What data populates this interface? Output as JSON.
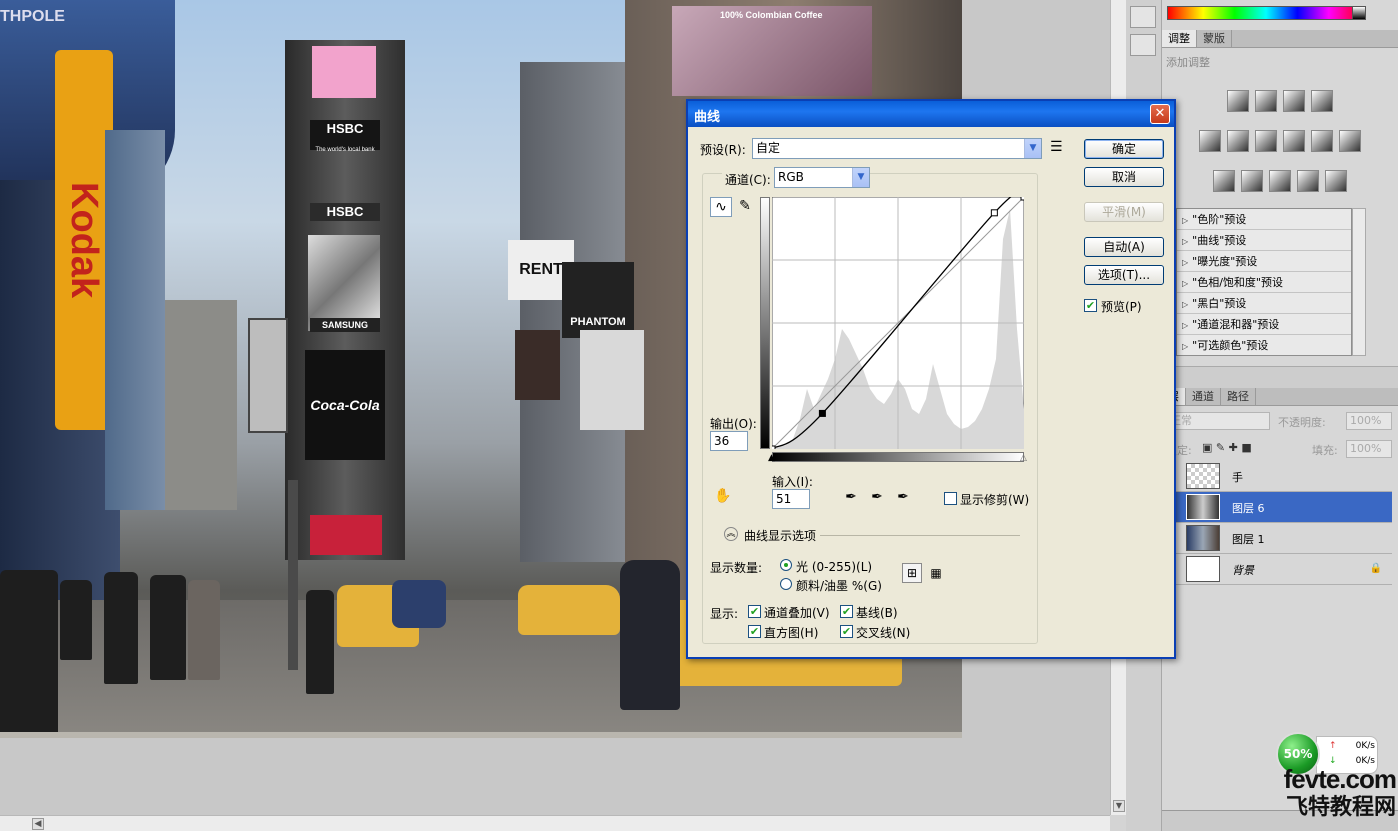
{
  "canvas": {
    "signs": {
      "kodak": "Kodak",
      "hsbc1": "HSBC",
      "hsbc_tagline": "The world's local bank",
      "hsbc2": "HSBC",
      "samsung": "SAMSUNG",
      "coca_cola": "Coca-Cola",
      "rent": "RENT",
      "phantom": "PHANTOM",
      "colombian": "100% Colombian Coffee",
      "thpole": "THPOLE"
    }
  },
  "dialog": {
    "title": "曲线",
    "preset_label": "预设(R):",
    "preset_value": "自定",
    "channel_label": "通道(C):",
    "channel_value": "RGB",
    "buttons": {
      "ok": "确定",
      "cancel": "取消",
      "smooth": "平滑(M)",
      "auto": "自动(A)",
      "options": "选项(T)..."
    },
    "preview_label": "预览(P)",
    "output_label": "输出(O):",
    "output_value": "36",
    "input_label": "输入(I):",
    "input_value": "51",
    "show_clipping_label": "显示修剪(W)",
    "display_options_label": "曲线显示选项",
    "show_amount_label": "显示数量:",
    "light_label": "光 (0-255)(L)",
    "pigment_label": "颜料/油墨 %(G)",
    "show_label": "显示:",
    "channel_overlay_label": "通道叠加(V)",
    "baseline_label": "基线(B)",
    "histogram_label": "直方图(H)",
    "intersection_label": "交叉线(N)"
  },
  "curve": {
    "points": [
      [
        0,
        0
      ],
      [
        51,
        36
      ],
      [
        225,
        239
      ],
      [
        255,
        255
      ]
    ],
    "selected_point": [
      51,
      36
    ]
  },
  "panels": {
    "adjust_tabs": [
      "调整",
      "蒙版"
    ],
    "adjust_title": "添加调整",
    "presets": [
      "\"色阶\"预设",
      "\"曲线\"预设",
      "\"曝光度\"预设",
      "\"色相/饱和度\"预设",
      "\"黑白\"预设",
      "\"通道混和器\"预设",
      "\"可选颜色\"预设"
    ],
    "layer_tabs": [
      "层",
      "通道",
      "路径"
    ],
    "blend_mode": "正常",
    "opacity_label": "不透明度:",
    "opacity_value": "100%",
    "lock_label": "锁定:",
    "fill_label": "填充:",
    "fill_value": "100%",
    "layers": [
      {
        "name": "手",
        "selected": false
      },
      {
        "name": "图层 6",
        "selected": true
      },
      {
        "name": "图层 1",
        "selected": false
      },
      {
        "name": "背景",
        "selected": false
      }
    ]
  },
  "net": {
    "percent": "50%",
    "up": "0K/s",
    "down": "0K/s"
  },
  "watermark": {
    "line1": "fevte.com",
    "line2": "飞特教程网"
  }
}
